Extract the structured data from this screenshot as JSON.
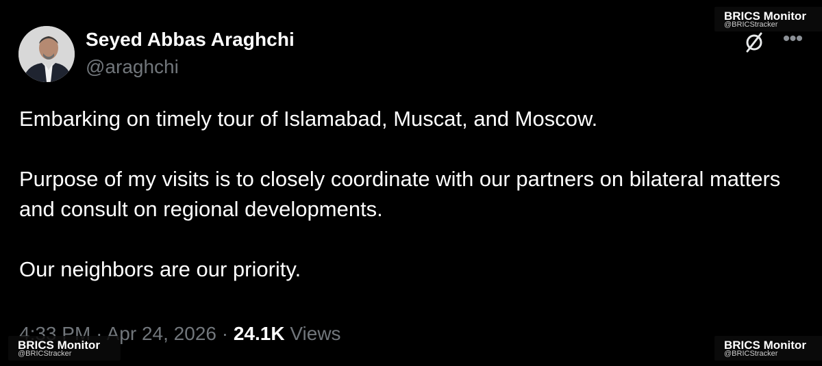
{
  "post": {
    "author": {
      "display_name": "Seyed Abbas Araghchi",
      "handle": "@araghchi",
      "avatar_icon": "person-avatar"
    },
    "text_paragraphs": [
      "Embarking on timely tour of Islamabad, Muscat, and Moscow.",
      "Purpose of my visits is to closely coordinate with our partners on bilateral matters and consult on regional developments.",
      "Our neighbors are our priority."
    ],
    "meta": {
      "time": "4:33 PM",
      "separator": "·",
      "date": "Apr 24, 2026",
      "views_count": "24.1K",
      "views_label": "Views"
    },
    "icons": {
      "grok": "grok-icon",
      "more": "more-options-icon",
      "more_glyph": "•••"
    }
  },
  "watermarks": {
    "top_right": {
      "title": "BRICS Monitor",
      "handle": "@BRICStracker"
    },
    "bottom_left": {
      "title": "BRICS Monitor",
      "handle": "@BRICStracker"
    },
    "bottom_right": {
      "title": "BRICS Monitor",
      "handle": "@BRICStracker"
    }
  },
  "colors": {
    "background": "#000000",
    "primary_text": "#ffffff",
    "secondary_text": "#71767b"
  }
}
